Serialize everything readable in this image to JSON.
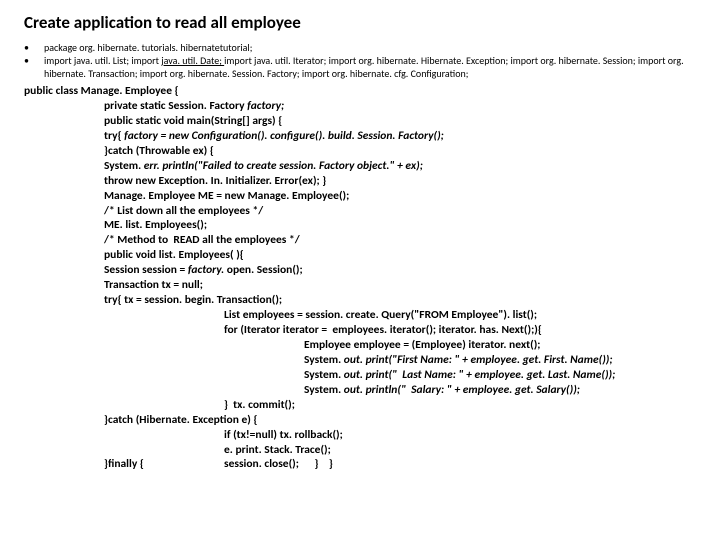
{
  "title": "Create application to read all employee",
  "bullet1": "package org. hibernate. tutorials. hibernatetutorial;",
  "bullet2a": "import java. util. List; import ",
  "bullet2u": "java. util. Date; ",
  "bullet2b": "import java. util. Iterator; import org. hibernate. Hibernate. Exception; import org. hibernate. Session; import org. hibernate. Transaction; import org. hibernate. Session. Factory; import org. hibernate. cfg. Configuration;",
  "c01a": "public class ",
  "c01b": "Manage. Employee {",
  "c02a": "private static ",
  "c02b": "Session. Factory ",
  "c02c": "factory;",
  "c03": "public static void main(String[] args) {",
  "c04a": "try{",
  "c04b": " factory = new ",
  "c04c": "Configuration(). configure(). build. Session. Factory();",
  "c05a": "}",
  "c05b": "catch ",
  "c05c": "(Throwable ex) {",
  "c06a": "System. ",
  "c06b": "err. println",
  "c06c": "(\"Failed to create session. Factory object.\" + ex);",
  "c07a": "throw new ",
  "c07b": "Exception. In. Initializer. Error(ex); }",
  "c08a": "Manage. Employee ME = ",
  "c08b": "new ",
  "c08c": "Manage. Employee();",
  "c09": "/* List down all the employees */",
  "c10": "ME. list. Employees();",
  "c11": "/* Method to  READ all the employees */",
  "c12a": "public void ",
  "c12b": "list. Employees( ){",
  "c13a": "Session session = ",
  "c13b": "factory. ",
  "c13c": "open. Session();",
  "c14a": "Transaction tx = ",
  "c14b": "null;",
  "c15a": "try",
  "c15b": "{ tx = session. begin. Transaction();",
  "c16": "List employees = session. create. Query(\"FROM Employee\"). list();",
  "c17a": "for ",
  "c17b": "(Iterator iterator =  employees. iterator(); iterator. has. Next();){",
  "c18": "Employee employee = (Employee) iterator. next();",
  "c19a": "System. ",
  "c19b": "out. print",
  "c19c": "(\"First Name: \" + employee. get. First. Name());",
  "c20a": "System. ",
  "c20b": "out. print",
  "c20c": "(\"  Last Name: \" + employee. get. Last. Name());",
  "c21a": "System. ",
  "c21b": "out. println",
  "c21c": "(\"  Salary: \" + employee. get. Salary());",
  "c22": "}  tx. commit();",
  "c23a": "}",
  "c23b": "catch ",
  "c23c": "(Hibernate. Exception e) {",
  "c24a": "if ",
  "c24b": "(tx!=null) tx. rollback();",
  "c25": "e. print. Stack. Trace();",
  "c26a": "}finally {",
  "c26b": "session. close();      }    }"
}
